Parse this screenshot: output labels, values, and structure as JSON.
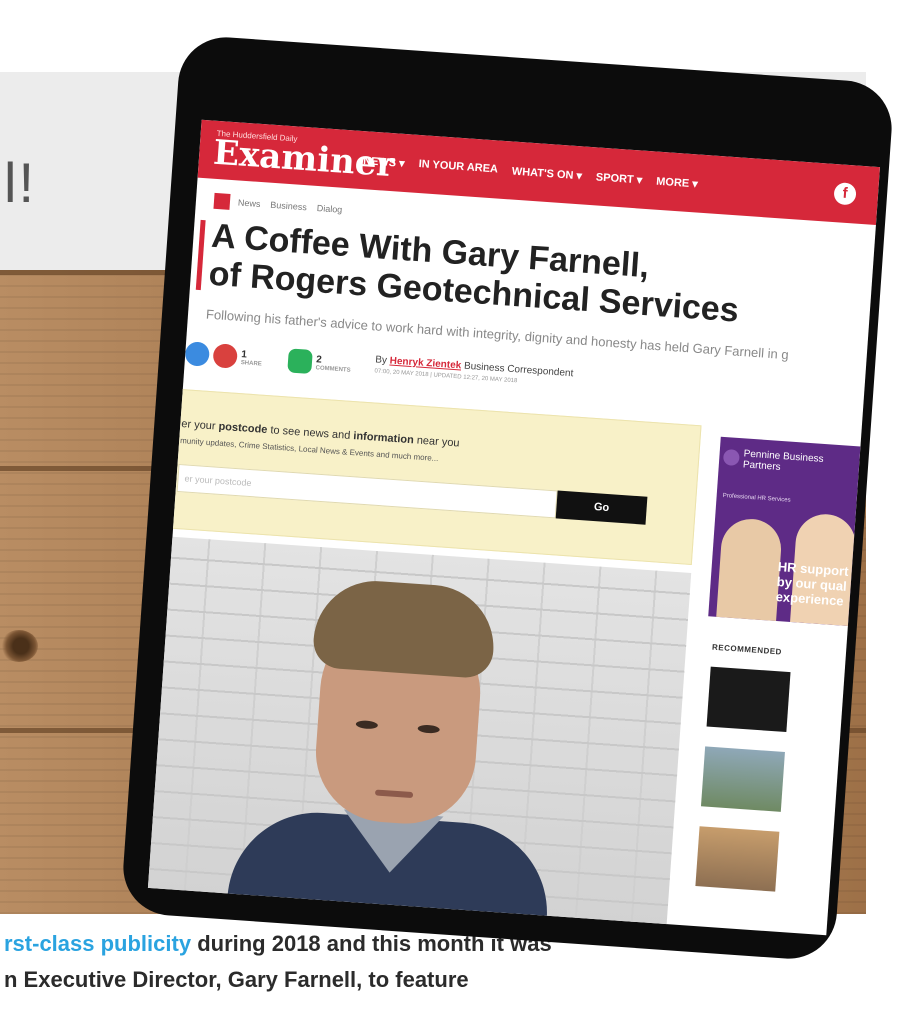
{
  "page": {
    "partial_title": "l!",
    "bottom_text": {
      "line1_highlight": "rst-class publicity",
      "line1_rest": " during 2018 and this month it was",
      "line2": "n Executive Director, Gary Farnell, to feature"
    }
  },
  "article": {
    "logo_small": "The Huddersfield Daily",
    "logo": "Examiner",
    "nav": [
      "NEWS ▾",
      "IN YOUR AREA",
      "WHAT'S ON ▾",
      "SPORT ▾",
      "MORE ▾"
    ],
    "facebook_glyph": "f",
    "breadcrumbs": [
      "News",
      "Business",
      "Dialog"
    ],
    "headline_line1": "A Coffee With Gary Farnell,",
    "headline_line2": "of Rogers Geotechnical Services",
    "standfirst": "Following his father's advice to work hard with integrity, dignity and honesty has held Gary Farnell in g",
    "shares_count": "1",
    "shares_label": "SHARE",
    "comments_count": "2",
    "comments_label": "COMMENTS",
    "byline_prefix": "By",
    "byline_author": "Henryk Zientek",
    "byline_role": "Business Correspondent",
    "byline_meta": "07:00, 20 MAY 2018  |  UPDATED 12:27, 20 MAY 2018",
    "postcode_line1_pre": "er your ",
    "postcode_line1_b1": "postcode",
    "postcode_line1_mid": " to see news and ",
    "postcode_line1_b2": "information",
    "postcode_line1_post": " near you",
    "postcode_line2": "munity updates, Crime Statistics, Local News & Events and much more...",
    "postcode_placeholder": "er your postcode",
    "go_label": "Go",
    "ad_brand": "Pennine Business Partners",
    "ad_sub": "Professional HR Services",
    "ad_text": "HR support by our qual experience",
    "recommended_label": "RECOMMENDED"
  },
  "colors": {
    "brand_red": "#d6283a",
    "accent_blue": "#2aa3e0",
    "ad_purple": "#5e2b86"
  }
}
